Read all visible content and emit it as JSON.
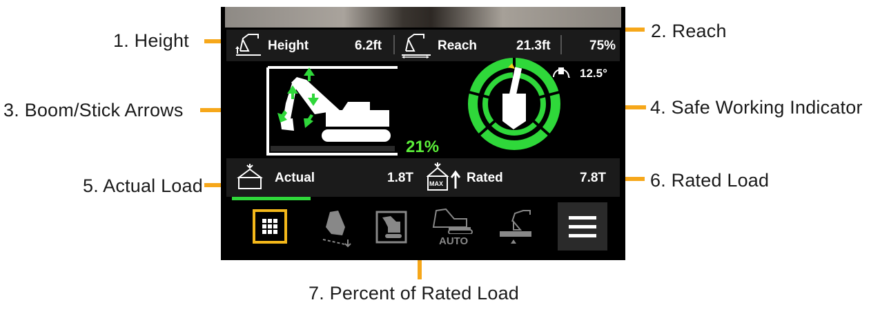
{
  "callouts": {
    "height": "1. Height",
    "reach": "2. Reach",
    "boom": "3. Boom/Stick Arrows",
    "safe": "4. Safe Working Indicator",
    "actual": "5. Actual Load",
    "rated": "6. Rated Load",
    "percent": "7. Percent of Rated Load"
  },
  "screen": {
    "top_bar": {
      "height_label": "Height",
      "height_value": "6.2ft",
      "reach_label": "Reach",
      "reach_value": "21.3ft",
      "percent": "75%"
    },
    "tilt_value": "12.5°",
    "rated_percent": "21%",
    "load_bar": {
      "actual_label": "Actual",
      "actual_value": "1.8T",
      "rated_label": "Rated",
      "rated_value": "7.8T",
      "max_badge": "MAX"
    },
    "nav": {
      "auto_label": "AUTO"
    }
  },
  "colors": {
    "accent": "#f6a71a",
    "safe_green": "#2fd83a",
    "percent_green": "#5cf03a",
    "selected_border": "#f4b81a"
  },
  "icons": [
    "height-icon",
    "reach-icon",
    "tilt-icon",
    "excavator-icon",
    "bucket-icon",
    "hook-load-icon",
    "max-load-icon",
    "grid-icon",
    "bucket-path-icon",
    "frame-excavator-icon",
    "auto-excavator-icon",
    "grade-icon",
    "menu-icon"
  ]
}
